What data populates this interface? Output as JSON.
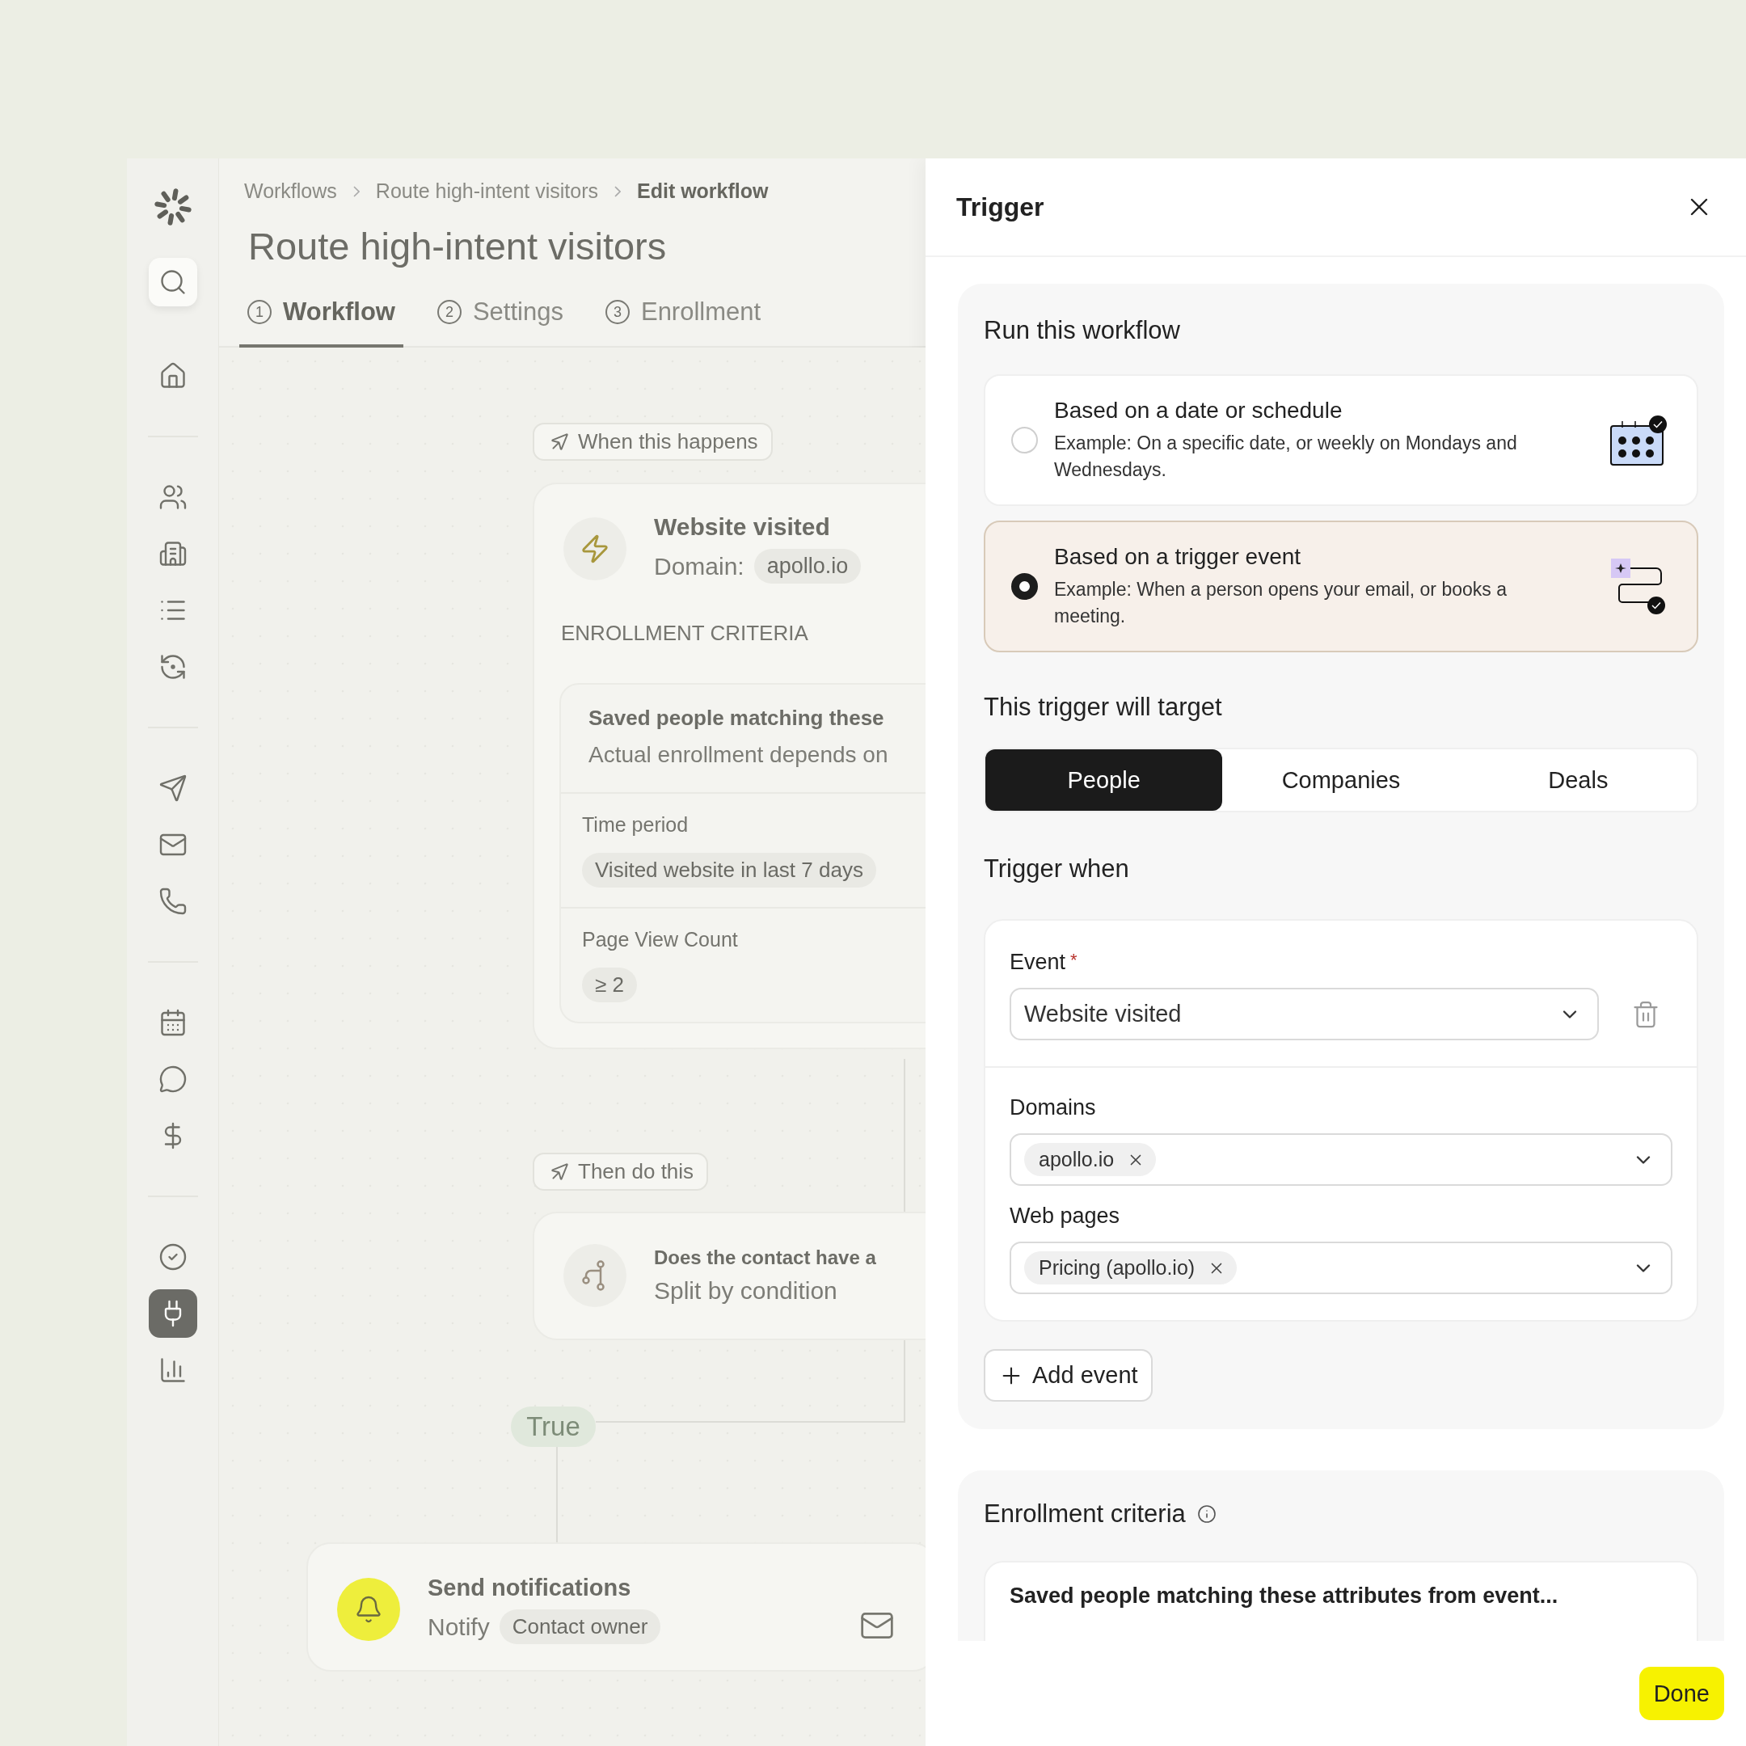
{
  "sidebar": {
    "groups": [
      [
        {
          "kind": "search",
          "selected": false
        },
        {
          "kind": "nav",
          "selected": false
        }
      ],
      [
        {
          "kind": "nav",
          "selected": false
        },
        {
          "kind": "nav",
          "selected": false
        },
        {
          "kind": "nav",
          "selected": false
        },
        {
          "kind": "nav",
          "selected": false
        }
      ],
      [
        {
          "kind": "nav",
          "selected": false
        },
        {
          "kind": "nav",
          "selected": false
        },
        {
          "kind": "nav",
          "selected": false
        }
      ],
      [
        {
          "kind": "nav",
          "selected": false
        },
        {
          "kind": "nav",
          "selected": false
        },
        {
          "kind": "nav",
          "selected": false
        }
      ],
      [
        {
          "kind": "nav",
          "selected": false
        },
        {
          "kind": "nav",
          "selected": true
        },
        {
          "kind": "nav",
          "selected": false
        }
      ]
    ]
  },
  "breadcrumbs": [
    {
      "label": "Workflows",
      "current": false
    },
    {
      "label": "Route high-intent visitors",
      "current": false
    },
    {
      "label": "Edit workflow",
      "current": true
    }
  ],
  "title": "Route high-intent visitors",
  "tabs": [
    {
      "number": "1",
      "label": "Workflow",
      "selected": true
    },
    {
      "number": "2",
      "label": "Settings",
      "selected": false
    },
    {
      "number": "3",
      "label": "Enrollment",
      "selected": false
    }
  ],
  "canvas": {
    "trigger_pill": "When this happens",
    "trigger_card": {
      "title": "Website visited",
      "domain_label": "Domain:",
      "domain": "apollo.io",
      "criteria_heading": "ENROLLMENT CRITERIA",
      "criteria_title": "Saved people matching these",
      "criteria_subtitle": "Actual enrollment depends on",
      "fields": [
        {
          "label": "Time period",
          "value": "Visited website in last 7 days"
        },
        {
          "label": "Page View Count",
          "value": "≥ 2"
        }
      ]
    },
    "action_pill": "Then do this",
    "condition_card": {
      "title": "Does the contact have a",
      "subtitle": "Split by condition"
    },
    "branch_label": "True",
    "notify_card": {
      "title": "Send notifications",
      "label": "Notify",
      "recipient": "Contact owner"
    }
  },
  "panel": {
    "title": "Trigger",
    "run_section": {
      "heading": "Run this workflow",
      "options": [
        {
          "kind": "schedule",
          "title": "Based on a date or schedule",
          "description": "Example: On a specific date, or weekly on Mondays and Wednesdays.",
          "selected": false
        },
        {
          "kind": "event",
          "title": "Based on a trigger event",
          "description": "Example: When a person opens your email, or books a meeting.",
          "selected": true
        }
      ]
    },
    "target": {
      "heading": "This trigger will target",
      "options": [
        {
          "label": "People",
          "selected": true
        },
        {
          "label": "Companies",
          "selected": false
        },
        {
          "label": "Deals",
          "selected": false
        }
      ]
    },
    "trigger_when": {
      "heading": "Trigger when",
      "event": {
        "label": "Event",
        "required_mark": "*",
        "value": "Website visited"
      },
      "filters": [
        {
          "label": "Domains",
          "tags": [
            "apollo.io"
          ]
        },
        {
          "label": "Web pages",
          "tags": [
            "Pricing (apollo.io)"
          ]
        }
      ],
      "add_button": "Add event"
    },
    "enrollment": {
      "heading": "Enrollment criteria",
      "card_title": "Saved people matching these attributes from event..."
    },
    "done_button": "Done"
  }
}
